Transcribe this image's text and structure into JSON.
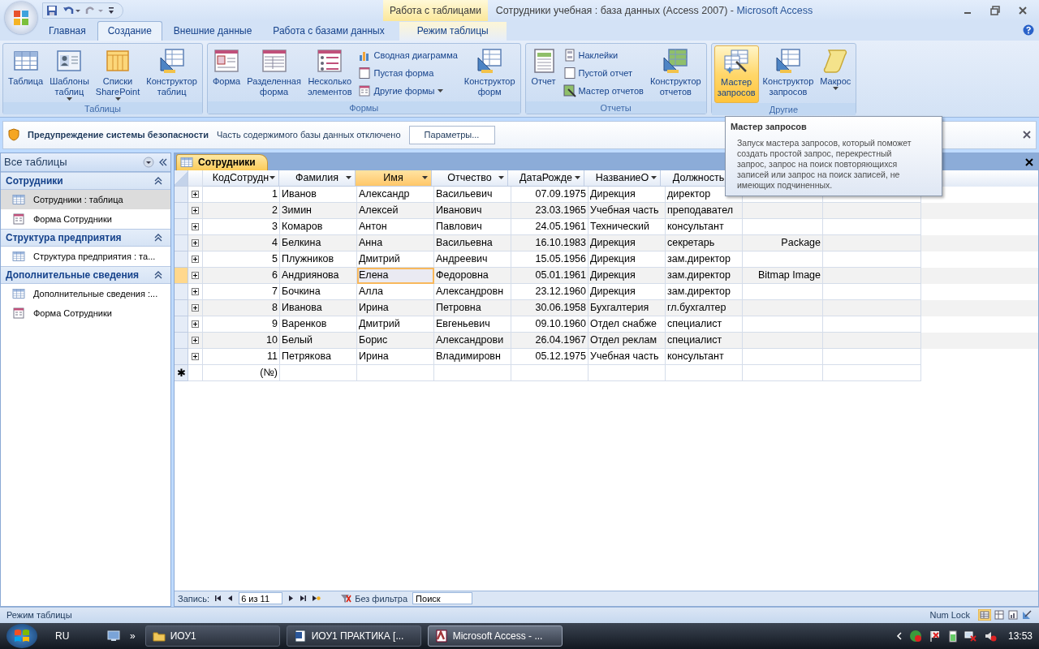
{
  "window": {
    "title": "Сотрудники учебная : база данных (Access 2007)",
    "separator": "-",
    "app": "Microsoft Access"
  },
  "context_tab": {
    "label": "Работа с таблицами"
  },
  "tabs": [
    {
      "label": "Главная",
      "kind": "standard",
      "selected": false
    },
    {
      "label": "Создание",
      "kind": "standard",
      "selected": true
    },
    {
      "label": "Внешние данные",
      "kind": "standard",
      "selected": false
    },
    {
      "label": "Работа с базами данных",
      "kind": "standard",
      "selected": false
    },
    {
      "label": "Режим таблицы",
      "kind": "contextual",
      "selected": false
    }
  ],
  "ribbon_groups": [
    {
      "title": "Таблицы",
      "buttons": [
        {
          "kind": "large",
          "label": "Таблица",
          "menu": false,
          "highlighted": false
        },
        {
          "kind": "large",
          "label": "Шаблоны\nтаблиц",
          "menu": true,
          "highlighted": false
        },
        {
          "kind": "large",
          "label": "Списки\nSharePoint",
          "menu": true,
          "highlighted": false
        },
        {
          "kind": "large",
          "label": "Конструктор\nтаблиц",
          "menu": false,
          "highlighted": false
        }
      ]
    },
    {
      "title": "Формы",
      "buttons": [
        {
          "kind": "large",
          "label": "Форма",
          "menu": false,
          "highlighted": false
        },
        {
          "kind": "large",
          "label": "Разделенная\nформа",
          "menu": false,
          "highlighted": false
        },
        {
          "kind": "large",
          "label": "Несколько\nэлементов",
          "menu": false,
          "highlighted": false
        },
        {
          "kind": "small",
          "label": "Сводная диаграмма",
          "menu": false,
          "highlighted": false
        },
        {
          "kind": "small",
          "label": "Пустая форма",
          "menu": false,
          "highlighted": false
        },
        {
          "kind": "small",
          "label": "Другие формы",
          "menu": true,
          "highlighted": false
        },
        {
          "kind": "large",
          "label": "Конструктор\nформ",
          "menu": false,
          "highlighted": false
        }
      ]
    },
    {
      "title": "Отчеты",
      "buttons": [
        {
          "kind": "large",
          "label": "Отчет",
          "menu": false,
          "highlighted": false
        },
        {
          "kind": "small",
          "label": "Наклейки",
          "menu": false,
          "highlighted": false
        },
        {
          "kind": "small",
          "label": "Пустой отчет",
          "menu": false,
          "highlighted": false
        },
        {
          "kind": "small",
          "label": "Мастер отчетов",
          "menu": false,
          "highlighted": false
        },
        {
          "kind": "large",
          "label": "Конструктор\nотчетов",
          "menu": false,
          "highlighted": false
        }
      ]
    },
    {
      "title": "Другие",
      "buttons": [
        {
          "kind": "large",
          "label": "Мастер\nзапросов",
          "menu": false,
          "highlighted": true
        },
        {
          "kind": "large",
          "label": "Конструктор\nзапросов",
          "menu": false,
          "highlighted": false
        },
        {
          "kind": "large",
          "label": "Макрос",
          "menu": true,
          "highlighted": false
        }
      ]
    }
  ],
  "security_bar": {
    "title": "Предупреждение системы безопасности",
    "message": "Часть содержимого базы данных отключено",
    "button": "Параметры..."
  },
  "tooltip": {
    "title": "Мастер запросов",
    "text": "Запуск мастера запросов, который поможет создать простой запрос, перекрестный запрос, запрос на поиск повторяющихся записей или запрос на поиск записей, не имеющих подчиненных."
  },
  "navigation": {
    "title": "Все таблицы",
    "groups": [
      {
        "title": "Сотрудники",
        "items": [
          {
            "kind": "table",
            "label": "Сотрудники : таблица",
            "selected": true
          },
          {
            "kind": "form",
            "label": "Форма Сотрудники",
            "selected": false
          }
        ]
      },
      {
        "title": "Структура предприятия",
        "items": [
          {
            "kind": "table",
            "label": "Структура предприятия : та...",
            "selected": false
          }
        ]
      },
      {
        "title": "Дополнительные сведения",
        "items": [
          {
            "kind": "table",
            "label": "Дополнительные сведения :...",
            "selected": false
          },
          {
            "kind": "form",
            "label": "Форма Сотрудники",
            "selected": false
          }
        ]
      }
    ]
  },
  "document_tab": {
    "label": "Сотрудники"
  },
  "table": {
    "columns": [
      {
        "label": "КодСотрудн",
        "kind": "number",
        "selected": false
      },
      {
        "label": "Фамилия",
        "kind": "text",
        "selected": false
      },
      {
        "label": "Имя",
        "kind": "text",
        "selected": true
      },
      {
        "label": "Отчество",
        "kind": "text",
        "selected": false
      },
      {
        "label": "ДатаРожде",
        "kind": "date",
        "selected": false
      },
      {
        "label": "НазваниеО",
        "kind": "text",
        "selected": false
      },
      {
        "label": "Должность",
        "kind": "text",
        "selected": false
      }
    ],
    "rows": [
      {
        "cells": [
          "1",
          "Иванов",
          "Александр",
          "Васильевич",
          "07.09.1975",
          "Дирекция",
          "директор"
        ],
        "selected": false
      },
      {
        "cells": [
          "2",
          "Зимин",
          "Алексей",
          "Иванович",
          "23.03.1965",
          "Учебная часть",
          "преподавател"
        ],
        "selected": false
      },
      {
        "cells": [
          "3",
          "Комаров",
          "Антон",
          "Павлович",
          "24.05.1961",
          "Технический",
          "консультант"
        ],
        "selected": false
      },
      {
        "cells": [
          "4",
          "Белкина",
          "Анна",
          "Васильевна",
          "16.10.1983",
          "Дирекция",
          "секретарь"
        ],
        "object": "Package",
        "selected": false
      },
      {
        "cells": [
          "5",
          "Плужников",
          "Дмитрий",
          "Андреевич",
          "15.05.1956",
          "Дирекция",
          "зам.директор"
        ],
        "selected": false
      },
      {
        "cells": [
          "6",
          "Андриянова",
          "Елена",
          "Федоровна",
          "05.01.1961",
          "Дирекция",
          "зам.директор"
        ],
        "object": "Bitmap Image",
        "selected": true
      },
      {
        "cells": [
          "7",
          "Бочкина",
          "Алла",
          "Александровн",
          "23.12.1960",
          "Дирекция",
          "зам.директор"
        ],
        "selected": false
      },
      {
        "cells": [
          "8",
          "Иванова",
          "Ирина",
          "Петровна",
          "30.06.1958",
          "Бухгалтерия",
          "гл.бухгалтер"
        ],
        "selected": false
      },
      {
        "cells": [
          "9",
          "Варенков",
          "Дмитрий",
          "Евгеньевич",
          "09.10.1960",
          "Отдел снабже",
          "специалист"
        ],
        "selected": false
      },
      {
        "cells": [
          "10",
          "Белый",
          "Борис",
          "Александрови",
          "26.04.1967",
          "Отдел реклам",
          "специалист"
        ],
        "selected": false
      },
      {
        "cells": [
          "11",
          "Петрякова",
          "Ирина",
          "Владимировн",
          "05.12.1975",
          "Учебная часть",
          "консультант"
        ],
        "selected": false
      }
    ],
    "new_row": {
      "marker": "✱",
      "placeholder": "(№)"
    }
  },
  "record_nav": {
    "label": "Запись:",
    "current": "6 из 11",
    "filter": "Без фильтра",
    "search_placeholder": "Поиск"
  },
  "status_bar": {
    "mode": "Режим таблицы",
    "num_lock": "Num Lock"
  },
  "taskbar": {
    "language": "RU",
    "more": "»",
    "tasks": [
      {
        "label": "ИОУ1",
        "kind": "folder",
        "selected": false
      },
      {
        "label": "ИОУ1 ПРАКТИКА [...",
        "kind": "document",
        "selected": false
      },
      {
        "label": "Microsoft Access - ...",
        "kind": "access",
        "selected": true
      }
    ],
    "clock": "13:53"
  }
}
